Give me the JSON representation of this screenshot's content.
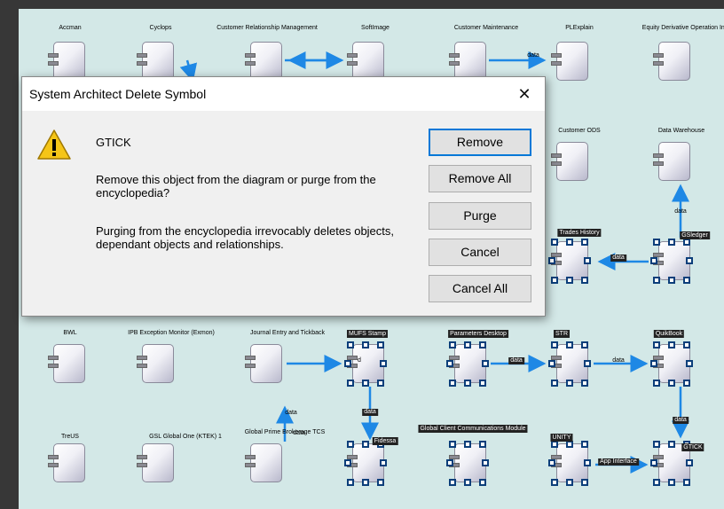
{
  "canvas": {
    "components": [
      {
        "label": "Accman",
        "sel": false
      },
      {
        "label": "Cyclops",
        "sel": false
      },
      {
        "label": "Customer Relationship Management",
        "sel": false
      },
      {
        "label": "SoftImage",
        "sel": false
      },
      {
        "label": "Customer Maintenance",
        "sel": false
      },
      {
        "label": "PLExplain",
        "sel": false
      },
      {
        "label": "Equity Derivative Operation Interface",
        "sel": false
      },
      {
        "label": "Customer ODS",
        "sel": false
      },
      {
        "label": "Data Warehouse",
        "sel": false
      },
      {
        "label": "Trades History",
        "sel": true
      },
      {
        "label": "GSledger",
        "sel": true
      },
      {
        "label": "BWL",
        "sel": false
      },
      {
        "label": "IPB Exception Monitor (Exmon)",
        "sel": false
      },
      {
        "label": "Journal Entry and Tickback",
        "sel": false
      },
      {
        "label": "MUFS Stamp",
        "sel": true
      },
      {
        "label": "Parameters Desktop",
        "sel": true
      },
      {
        "label": "STR",
        "sel": true
      },
      {
        "label": "QuikBook",
        "sel": true
      },
      {
        "label": "TreUS",
        "sel": false
      },
      {
        "label": "GSL Global One (KTEK) 1",
        "sel": false
      },
      {
        "label": "Global Prime Brokerage TCS",
        "sel": false
      },
      {
        "label": "Fidessa",
        "sel": true
      },
      {
        "label": "Global Client Communications Module",
        "sel": true
      },
      {
        "label": "UNITY",
        "sel": true
      },
      {
        "label": "GTICK",
        "sel": true
      }
    ],
    "flow_labels": [
      "data",
      "data",
      "data",
      "d",
      "data",
      "data",
      "data",
      "data",
      "data",
      "data"
    ],
    "app_interface_label": "App Interface"
  },
  "dialog": {
    "title": "System Architect Delete Symbol",
    "close_glyph": "✕",
    "icon": "warning-icon",
    "object_name": "GTICK",
    "question": "Remove this object from the diagram or purge from the encyclopedia?",
    "warning": "Purging from the encyclopedia irrevocably deletes objects, dependant objects and relationships.",
    "buttons": {
      "remove": "Remove",
      "remove_all": "Remove All",
      "purge": "Purge",
      "cancel": "Cancel",
      "cancel_all": "Cancel All"
    }
  },
  "colors": {
    "canvas_bg": "#d3e8e7",
    "arrow": "#1e88e5",
    "dialog_bg": "#f0f0f0",
    "focus": "#0078d7",
    "desktop": "#373737"
  }
}
